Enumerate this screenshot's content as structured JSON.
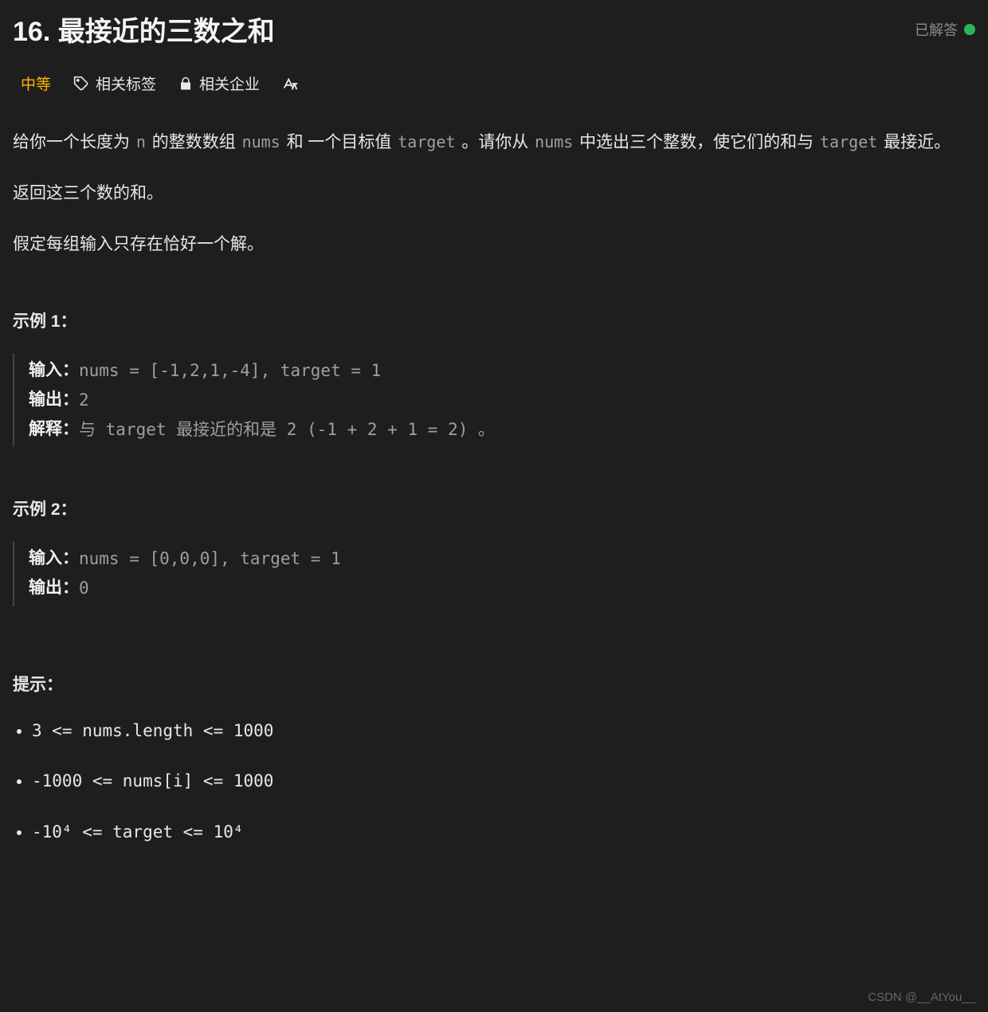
{
  "header": {
    "title": "16. 最接近的三数之和",
    "status_label": "已解答"
  },
  "tabs": {
    "difficulty": "中等",
    "tags": "相关标签",
    "companies": "相关企业"
  },
  "description": {
    "p1_a": "给你一个长度为 ",
    "p1_code1": "n",
    "p1_b": " 的整数数组 ",
    "p1_code2": "nums",
    "p1_c": " 和 一个目标值 ",
    "p1_code3": "target",
    "p1_d": " 。请你从 ",
    "p1_code4": "nums",
    "p1_e": " 中选出三个整数，使它们的和与 ",
    "p1_code5": "target",
    "p1_f": " 最接近。",
    "p2": "返回这三个数的和。",
    "p3": "假定每组输入只存在恰好一个解。"
  },
  "example_labels": {
    "ex1": "示例 1：",
    "ex2": "示例 2：",
    "input": "输入：",
    "output": "输出：",
    "explain": "解释："
  },
  "examples": [
    {
      "input": "nums = [-1,2,1,-4], target = 1",
      "output": "2",
      "explain": "与 target 最接近的和是 2 (-1 + 2 + 1 = 2) 。"
    },
    {
      "input": "nums = [0,0,0], target = 1",
      "output": "0"
    }
  ],
  "hints_label": "提示：",
  "constraints": [
    "3 <= nums.length <= 1000",
    "-1000 <= nums[i] <= 1000",
    "-10⁴ <= target <= 10⁴"
  ],
  "watermark": "CSDN @__AtYou__"
}
